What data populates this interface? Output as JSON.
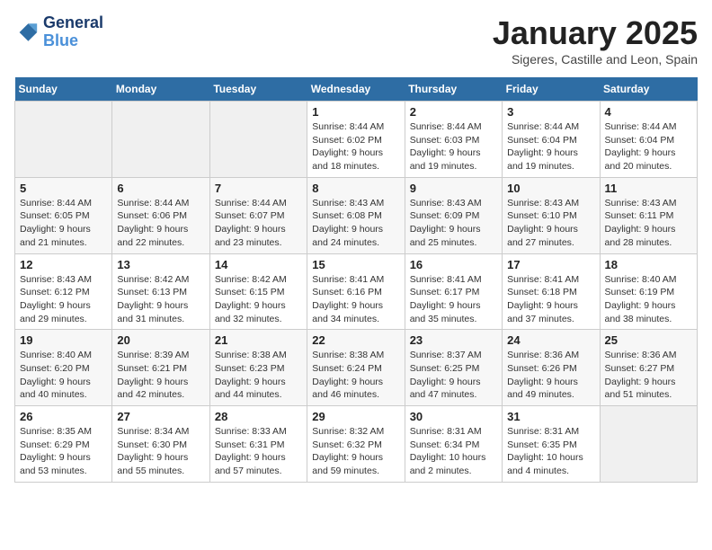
{
  "header": {
    "logo_line1": "General",
    "logo_line2": "Blue",
    "month": "January 2025",
    "location": "Sigeres, Castille and Leon, Spain"
  },
  "weekdays": [
    "Sunday",
    "Monday",
    "Tuesday",
    "Wednesday",
    "Thursday",
    "Friday",
    "Saturday"
  ],
  "weeks": [
    [
      {
        "day": "",
        "info": ""
      },
      {
        "day": "",
        "info": ""
      },
      {
        "day": "",
        "info": ""
      },
      {
        "day": "1",
        "info": "Sunrise: 8:44 AM\nSunset: 6:02 PM\nDaylight: 9 hours\nand 18 minutes."
      },
      {
        "day": "2",
        "info": "Sunrise: 8:44 AM\nSunset: 6:03 PM\nDaylight: 9 hours\nand 19 minutes."
      },
      {
        "day": "3",
        "info": "Sunrise: 8:44 AM\nSunset: 6:04 PM\nDaylight: 9 hours\nand 19 minutes."
      },
      {
        "day": "4",
        "info": "Sunrise: 8:44 AM\nSunset: 6:04 PM\nDaylight: 9 hours\nand 20 minutes."
      }
    ],
    [
      {
        "day": "5",
        "info": "Sunrise: 8:44 AM\nSunset: 6:05 PM\nDaylight: 9 hours\nand 21 minutes."
      },
      {
        "day": "6",
        "info": "Sunrise: 8:44 AM\nSunset: 6:06 PM\nDaylight: 9 hours\nand 22 minutes."
      },
      {
        "day": "7",
        "info": "Sunrise: 8:44 AM\nSunset: 6:07 PM\nDaylight: 9 hours\nand 23 minutes."
      },
      {
        "day": "8",
        "info": "Sunrise: 8:43 AM\nSunset: 6:08 PM\nDaylight: 9 hours\nand 24 minutes."
      },
      {
        "day": "9",
        "info": "Sunrise: 8:43 AM\nSunset: 6:09 PM\nDaylight: 9 hours\nand 25 minutes."
      },
      {
        "day": "10",
        "info": "Sunrise: 8:43 AM\nSunset: 6:10 PM\nDaylight: 9 hours\nand 27 minutes."
      },
      {
        "day": "11",
        "info": "Sunrise: 8:43 AM\nSunset: 6:11 PM\nDaylight: 9 hours\nand 28 minutes."
      }
    ],
    [
      {
        "day": "12",
        "info": "Sunrise: 8:43 AM\nSunset: 6:12 PM\nDaylight: 9 hours\nand 29 minutes."
      },
      {
        "day": "13",
        "info": "Sunrise: 8:42 AM\nSunset: 6:13 PM\nDaylight: 9 hours\nand 31 minutes."
      },
      {
        "day": "14",
        "info": "Sunrise: 8:42 AM\nSunset: 6:15 PM\nDaylight: 9 hours\nand 32 minutes."
      },
      {
        "day": "15",
        "info": "Sunrise: 8:41 AM\nSunset: 6:16 PM\nDaylight: 9 hours\nand 34 minutes."
      },
      {
        "day": "16",
        "info": "Sunrise: 8:41 AM\nSunset: 6:17 PM\nDaylight: 9 hours\nand 35 minutes."
      },
      {
        "day": "17",
        "info": "Sunrise: 8:41 AM\nSunset: 6:18 PM\nDaylight: 9 hours\nand 37 minutes."
      },
      {
        "day": "18",
        "info": "Sunrise: 8:40 AM\nSunset: 6:19 PM\nDaylight: 9 hours\nand 38 minutes."
      }
    ],
    [
      {
        "day": "19",
        "info": "Sunrise: 8:40 AM\nSunset: 6:20 PM\nDaylight: 9 hours\nand 40 minutes."
      },
      {
        "day": "20",
        "info": "Sunrise: 8:39 AM\nSunset: 6:21 PM\nDaylight: 9 hours\nand 42 minutes."
      },
      {
        "day": "21",
        "info": "Sunrise: 8:38 AM\nSunset: 6:23 PM\nDaylight: 9 hours\nand 44 minutes."
      },
      {
        "day": "22",
        "info": "Sunrise: 8:38 AM\nSunset: 6:24 PM\nDaylight: 9 hours\nand 46 minutes."
      },
      {
        "day": "23",
        "info": "Sunrise: 8:37 AM\nSunset: 6:25 PM\nDaylight: 9 hours\nand 47 minutes."
      },
      {
        "day": "24",
        "info": "Sunrise: 8:36 AM\nSunset: 6:26 PM\nDaylight: 9 hours\nand 49 minutes."
      },
      {
        "day": "25",
        "info": "Sunrise: 8:36 AM\nSunset: 6:27 PM\nDaylight: 9 hours\nand 51 minutes."
      }
    ],
    [
      {
        "day": "26",
        "info": "Sunrise: 8:35 AM\nSunset: 6:29 PM\nDaylight: 9 hours\nand 53 minutes."
      },
      {
        "day": "27",
        "info": "Sunrise: 8:34 AM\nSunset: 6:30 PM\nDaylight: 9 hours\nand 55 minutes."
      },
      {
        "day": "28",
        "info": "Sunrise: 8:33 AM\nSunset: 6:31 PM\nDaylight: 9 hours\nand 57 minutes."
      },
      {
        "day": "29",
        "info": "Sunrise: 8:32 AM\nSunset: 6:32 PM\nDaylight: 9 hours\nand 59 minutes."
      },
      {
        "day": "30",
        "info": "Sunrise: 8:31 AM\nSunset: 6:34 PM\nDaylight: 10 hours\nand 2 minutes."
      },
      {
        "day": "31",
        "info": "Sunrise: 8:31 AM\nSunset: 6:35 PM\nDaylight: 10 hours\nand 4 minutes."
      },
      {
        "day": "",
        "info": ""
      }
    ]
  ]
}
